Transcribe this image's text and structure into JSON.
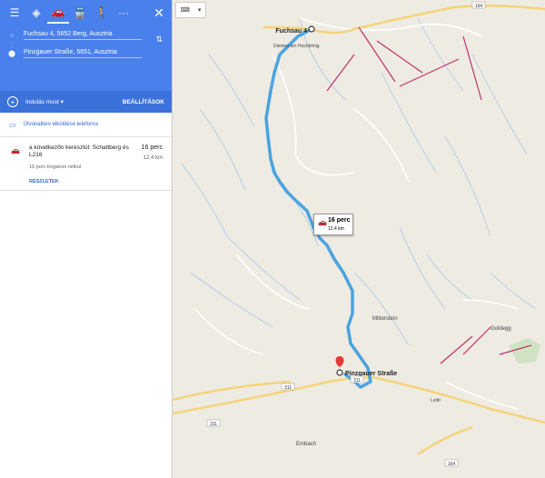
{
  "modes": [
    {
      "name": "menu-icon",
      "glyph": "☰"
    },
    {
      "name": "directions-icon",
      "glyph": "◈"
    },
    {
      "name": "car-icon",
      "glyph": "🚗"
    },
    {
      "name": "transit-icon",
      "glyph": "🚆"
    },
    {
      "name": "walk-icon",
      "glyph": "🚶"
    },
    {
      "name": "more-icon",
      "glyph": "···"
    }
  ],
  "close_glyph": "✕",
  "origin": "Fuchsau 4, 5652 Berg, Ausztria",
  "destination": "Pinzgauer Straße, 5651, Ausztria",
  "depart_label": "Indulás most",
  "settings_label": "BEÁLLÍTÁSOK",
  "send_label": "Útvonalterv elküldése telefonra",
  "route": {
    "via": "a következőn keresztül: Schattberg és L216",
    "time": "16 perc",
    "distance": "12,4 km",
    "traffic": "16 perc forgalom nélkül",
    "details": "RÉSZLETEK"
  },
  "map": {
    "start_label": "Fuchsau 4",
    "end_label": "Pinzgauer Straße",
    "bubble_time": "16 perc",
    "bubble_dist": "12,4 km",
    "places": [
      "Mitterstein",
      "Goldegg",
      "Embach",
      "Leibl",
      "Dienten am Hochkönig"
    ],
    "road_numbers": [
      "164",
      "311",
      "311",
      "311",
      "164"
    ],
    "colors": {
      "route": "#4aa3df",
      "road": "#f5d47a",
      "bg": "#eeebe3",
      "lift": "#c0306a",
      "header": "#4a80ec"
    }
  }
}
